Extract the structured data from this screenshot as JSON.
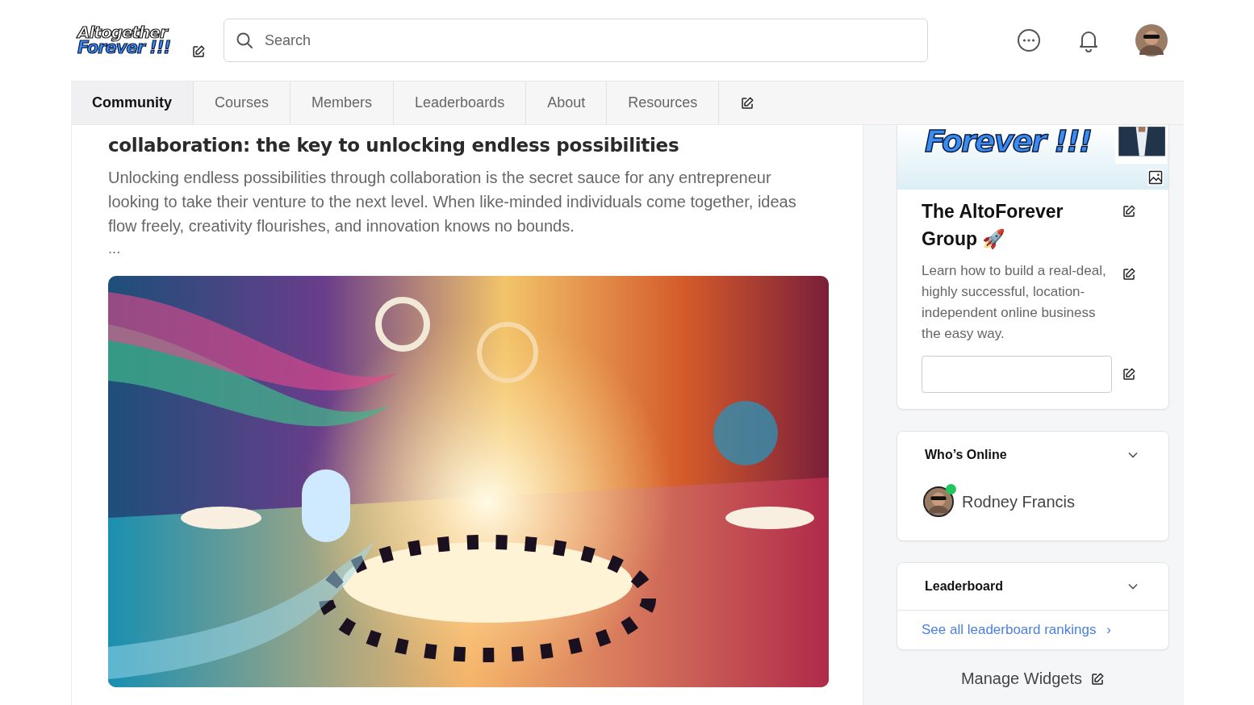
{
  "logo": {
    "line_1": "Altogether",
    "line_2": "Forever !!!"
  },
  "search": {
    "placeholder": "Search"
  },
  "nav": [
    {
      "label": "Community",
      "selected": true
    },
    {
      "label": "Courses",
      "selected": false
    },
    {
      "label": "Members",
      "selected": false
    },
    {
      "label": "Leaderboards",
      "selected": false
    },
    {
      "label": "About",
      "selected": false
    },
    {
      "label": "Resources",
      "selected": false
    }
  ],
  "post": {
    "title": "collaboration: the key to unlocking endless possibilities",
    "body": "Unlocking endless possibilities through collaboration is the secret sauce for any entrepreneur looking to take their venture to the next level. When like-minded individuals come together, ideas flow freely, creativity flourishes, and innovation knows no bounds.",
    "more": "..."
  },
  "group": {
    "banner_text": "Forever !!!",
    "name": "The AltoForever Group",
    "emoji": "🚀",
    "description": "Learn how to build a real-deal, highly successful, location-independent online business the easy way."
  },
  "whos_online": {
    "title": "Who’s Online",
    "members": [
      {
        "name": "Rodney Francis",
        "online": true
      }
    ]
  },
  "leaderboard": {
    "title": "Leaderboard",
    "link": "See all leaderboard rankings",
    "chevron": "›"
  },
  "manage_widgets": "Manage Widgets"
}
